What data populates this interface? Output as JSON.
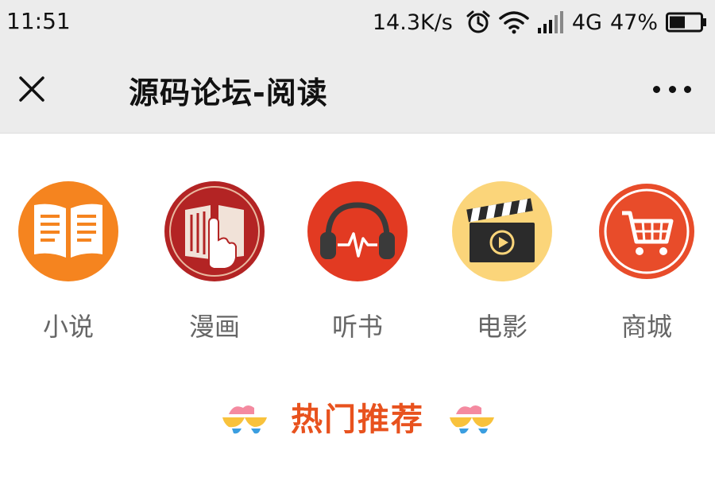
{
  "status_bar": {
    "time": "11:51",
    "speed": "14.3K/s",
    "network": "4G",
    "battery": "47%",
    "icons": [
      "alarm-icon",
      "wifi-icon",
      "signal-icon",
      "battery-icon"
    ]
  },
  "nav": {
    "title": "源码论坛-阅读",
    "close_icon": "close-icon",
    "more_icon": "more-icon"
  },
  "categories": [
    {
      "label": "小说",
      "icon": "open-book-icon",
      "color": "#f5841f"
    },
    {
      "label": "漫画",
      "icon": "comic-hand-icon",
      "color": "#b32424"
    },
    {
      "label": "听书",
      "icon": "headphones-icon",
      "color": "#e23a22"
    },
    {
      "label": "电影",
      "icon": "clapperboard-icon",
      "color": "#fbd57a"
    },
    {
      "label": "商城",
      "icon": "shopping-cart-icon",
      "color": "#e84c2a"
    }
  ],
  "hot_section": {
    "title": "热门推荐",
    "accent": "#e8521e"
  }
}
